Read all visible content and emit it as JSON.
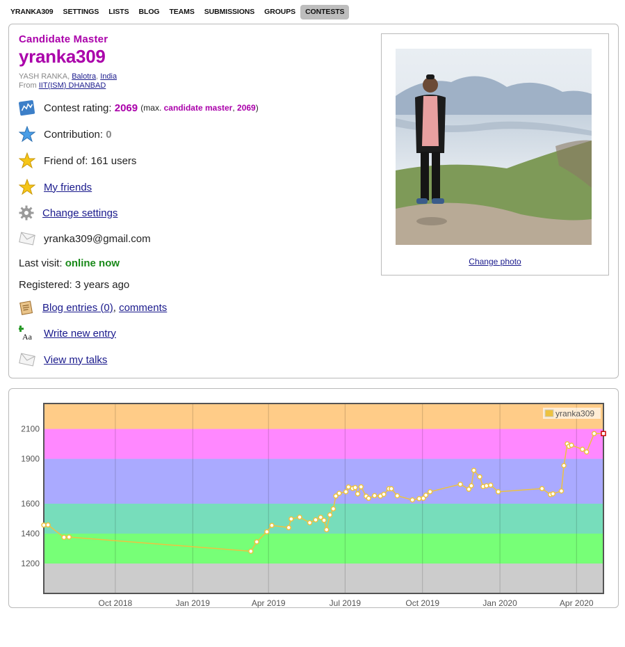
{
  "nav": {
    "items": [
      "YRANKA309",
      "SETTINGS",
      "LISTS",
      "BLOG",
      "TEAMS",
      "SUBMISSIONS",
      "GROUPS",
      "CONTESTS"
    ],
    "active": "CONTESTS"
  },
  "profile": {
    "rank": "Candidate Master",
    "handle": "yranka309",
    "name": "YASH RANKA",
    "city": "Balotra",
    "country": "India",
    "from_label": "From",
    "organization": "IIT(ISM) DHANBAD",
    "rating_label": "Contest rating:",
    "rating": "2069",
    "max_prefix": "(max.",
    "max_rank": "candidate master",
    "max_rating": "2069",
    "max_suffix": ")",
    "contribution_label": "Contribution:",
    "contribution": "0",
    "friend_of": "Friend of: 161 users",
    "my_friends": "My friends",
    "change_settings": "Change settings",
    "email": "yranka309@gmail.com",
    "last_visit_label": "Last visit:",
    "last_visit": "online now",
    "registered": "Registered: 3 years ago",
    "blog_entries": "Blog entries (0)",
    "comments": "comments",
    "write_entry": "Write new entry",
    "view_talks": "View my talks",
    "change_photo": "Change photo"
  },
  "colors": {
    "accent_purple": "#aa00aa",
    "online_green": "#1a8a1a",
    "link": "#1a1a8c",
    "band_gray": "#cccccc",
    "band_green": "#77ff77",
    "band_cyan": "#77ddbb",
    "band_blue": "#aaaaff",
    "band_violet": "#ff88ff",
    "band_orange": "#ffcc88",
    "series_line": "#edc240"
  },
  "chart_data": {
    "type": "line",
    "series": [
      {
        "name": "yranka309",
        "x": [
          "2018-07-08",
          "2018-07-13",
          "2018-08-01",
          "2018-08-07",
          "2019-03-11",
          "2019-03-18",
          "2019-03-30",
          "2019-04-05",
          "2019-04-25",
          "2019-04-28",
          "2019-05-08",
          "2019-05-20",
          "2019-05-27",
          "2019-06-02",
          "2019-06-06",
          "2019-06-09",
          "2019-06-13",
          "2019-06-17",
          "2019-06-20",
          "2019-06-24",
          "2019-07-02",
          "2019-07-05",
          "2019-07-10",
          "2019-07-13",
          "2019-07-16",
          "2019-07-20",
          "2019-07-26",
          "2019-07-29",
          "2019-08-05",
          "2019-08-12",
          "2019-08-16",
          "2019-08-22",
          "2019-08-25",
          "2019-09-01",
          "2019-09-19",
          "2019-09-27",
          "2019-10-02",
          "2019-10-05",
          "2019-10-10",
          "2019-11-15",
          "2019-11-25",
          "2019-11-28",
          "2019-12-01",
          "2019-12-08",
          "2019-12-12",
          "2019-12-16",
          "2019-12-21",
          "2019-12-30",
          "2020-02-20",
          "2020-03-01",
          "2020-03-04",
          "2020-03-14",
          "2020-03-17",
          "2020-03-21",
          "2020-03-23",
          "2020-03-26",
          "2020-04-08",
          "2020-04-13",
          "2020-04-22",
          "2020-05-03"
        ],
        "values": [
          1457,
          1458,
          1375,
          1377,
          1282,
          1345,
          1412,
          1455,
          1440,
          1498,
          1510,
          1473,
          1492,
          1509,
          1489,
          1426,
          1525,
          1566,
          1651,
          1670,
          1680,
          1712,
          1702,
          1708,
          1666,
          1713,
          1650,
          1636,
          1654,
          1651,
          1663,
          1700,
          1700,
          1653,
          1625,
          1634,
          1636,
          1657,
          1680,
          1730,
          1697,
          1720,
          1823,
          1780,
          1715,
          1720,
          1724,
          1680,
          1701,
          1661,
          1666,
          1685,
          1855,
          2000,
          1984,
          1991,
          1964,
          1946,
          2069,
          2069
        ]
      }
    ],
    "yticks": [
      1200,
      1400,
      1600,
      1900,
      2100
    ],
    "xticks": [
      "Oct 2018",
      "Jan 2019",
      "Apr 2019",
      "Jul 2019",
      "Oct 2019",
      "Jan 2020",
      "Apr 2020"
    ],
    "ylim": [
      1000,
      2270
    ],
    "xlim": [
      "2018-07-08",
      "2020-05-03"
    ],
    "rating_bands": [
      1200,
      1400,
      1600,
      1900,
      2100
    ],
    "grid": true,
    "legend": "top-right"
  }
}
